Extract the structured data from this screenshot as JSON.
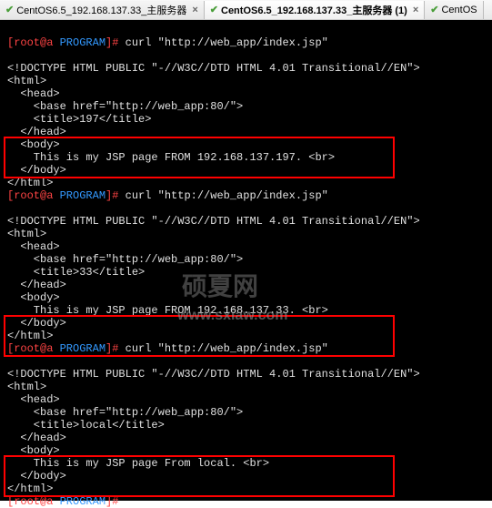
{
  "tabs": [
    {
      "label": "CentOS6.5_192.168.137.33_主服务器"
    },
    {
      "label": "CentOS6.5_192.168.137.33_主服务器 (1)"
    },
    {
      "label": "CentOS"
    }
  ],
  "prompt": {
    "user": "[root@a ",
    "path": "PROGRAM",
    "end": "]# "
  },
  "cmd": "curl \"http://web_app/index.jsp\"",
  "blocks": [
    {
      "doctype": "<!DOCTYPE HTML PUBLIC \"-//W3C//DTD HTML 4.01 Transitional//EN\">",
      "html_open": "<html>",
      "head_open": "  <head>",
      "base": "    <base href=\"http://web_app:80/\">",
      "title": "    <title>197</title>",
      "head_close": "  </head>",
      "body_open": "  <body>",
      "body_text": "    This is my JSP page FROM 192.168.137.197. <br>",
      "body_close": "  </body>",
      "html_close": "</html>"
    },
    {
      "doctype": "<!DOCTYPE HTML PUBLIC \"-//W3C//DTD HTML 4.01 Transitional//EN\">",
      "html_open": "<html>",
      "head_open": "  <head>",
      "base": "    <base href=\"http://web_app:80/\">",
      "title": "    <title>33</title>",
      "head_close": "  </head>",
      "body_open": "  <body>",
      "body_text": "    This is my JSP page FROM 192.168.137.33. <br>",
      "body_close": "  </body>",
      "html_close": "</html>"
    },
    {
      "doctype": "<!DOCTYPE HTML PUBLIC \"-//W3C//DTD HTML 4.01 Transitional//EN\">",
      "html_open": "<html>",
      "head_open": "  <head>",
      "base": "    <base href=\"http://web_app:80/\">",
      "title": "    <title>local</title>",
      "head_close": "  </head>",
      "body_open": "  <body>",
      "body_text": "    This is my JSP page From local. <br>",
      "body_close": "  </body>",
      "html_close": "</html>"
    }
  ],
  "watermark": {
    "text1": "硕夏网",
    "text2": "www.sxiaw.com"
  }
}
